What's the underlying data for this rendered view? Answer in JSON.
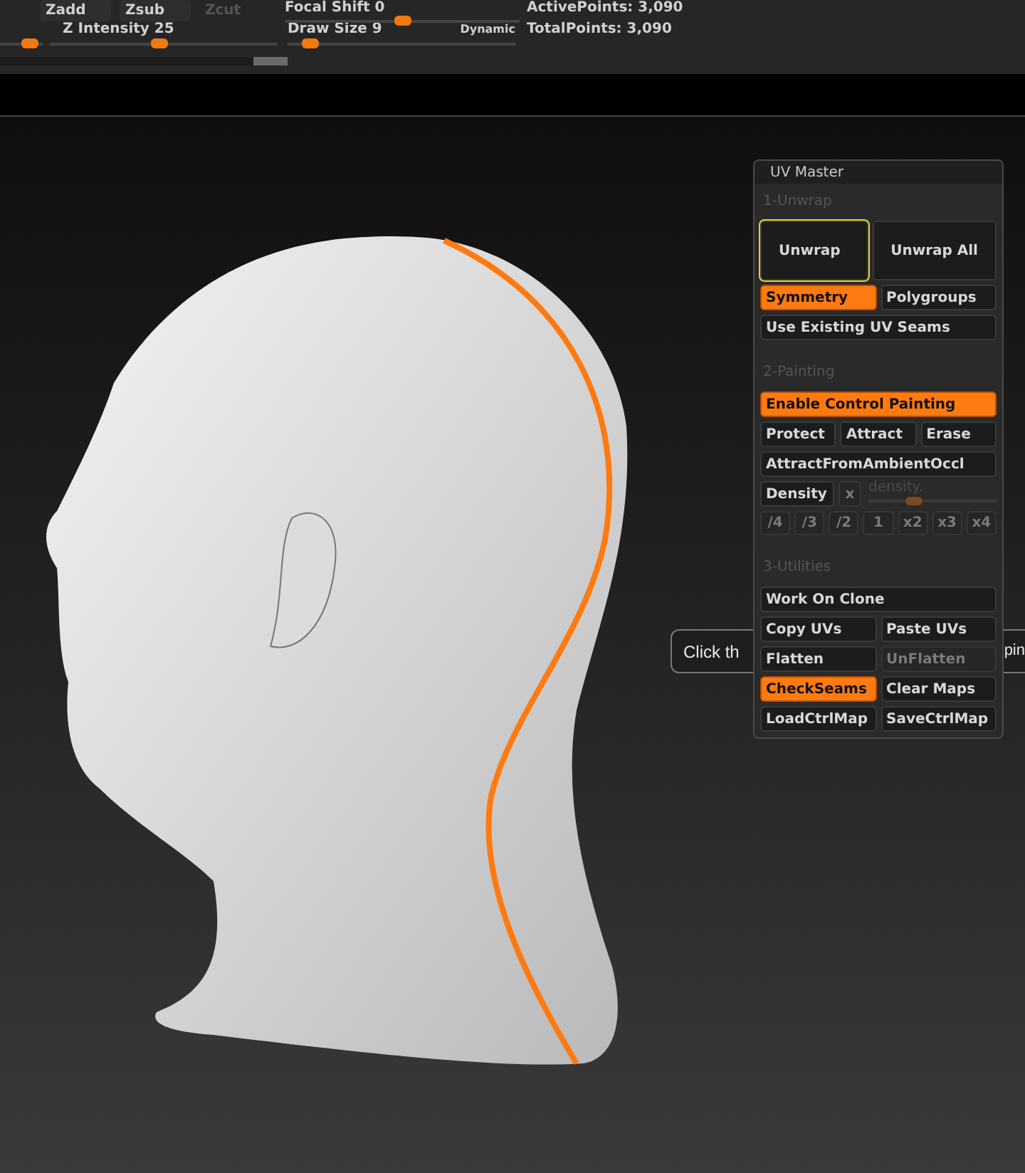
{
  "top_bar": {
    "brush_buttons": [
      {
        "label": "Zadd",
        "disabled": false
      },
      {
        "label": "Zsub",
        "disabled": false
      },
      {
        "label": "Zcut",
        "disabled": true
      }
    ],
    "left_slider": {
      "level": 0.7
    },
    "focal_shift": {
      "label": "Focal Shift 0",
      "level": 0.5
    },
    "active_points": "ActivePoints: 3,090",
    "z_intensity": {
      "label": "Z Intensity 25",
      "level": 0.48
    },
    "draw_size": {
      "label": "Draw Size 9",
      "level": 0.1
    },
    "dynamic": "Dynamic",
    "total_points": "TotalPoints: 3,090"
  },
  "tooltip": {
    "texts": [
      "Click th",
      "pin"
    ]
  },
  "uv_master": {
    "title": "UV Master",
    "sections": [
      {
        "heading": "1-Unwrap",
        "rows": [
          {
            "kind": "large",
            "buttons": [
              {
                "label": "Unwrap",
                "on": false,
                "disabled": false,
                "highlighted": true
              },
              {
                "label": "Unwrap All",
                "on": false,
                "disabled": false,
                "highlighted": false
              }
            ]
          },
          {
            "kind": "normal",
            "buttons": [
              {
                "label": "Symmetry",
                "on": true,
                "disabled": false,
                "highlighted": false
              },
              {
                "label": "Polygroups",
                "on": false,
                "disabled": false,
                "highlighted": false
              }
            ]
          },
          {
            "kind": "normal",
            "buttons": [
              {
                "label": "Use Existing UV Seams",
                "on": false,
                "disabled": false,
                "highlighted": false
              }
            ]
          }
        ]
      },
      {
        "heading": "2-Painting",
        "rows": [
          {
            "kind": "normal",
            "buttons": [
              {
                "label": "Enable Control Painting",
                "on": true,
                "disabled": false,
                "highlighted": false
              }
            ]
          },
          {
            "kind": "normal",
            "buttons": [
              {
                "label": "Protect",
                "on": false,
                "disabled": false,
                "highlighted": false
              },
              {
                "label": "Attract",
                "on": false,
                "disabled": false,
                "highlighted": false
              },
              {
                "label": "Erase",
                "on": false,
                "disabled": false,
                "highlighted": false
              }
            ]
          },
          {
            "kind": "normal",
            "buttons": [
              {
                "label": "AttractFromAmbientOccl",
                "on": false,
                "disabled": false,
                "highlighted": false
              }
            ]
          },
          {
            "kind": "density",
            "buttons": [
              {
                "label": "Density",
                "on": false,
                "disabled": false,
                "highlighted": false
              },
              {
                "label": "x",
                "on": false,
                "disabled": true,
                "highlighted": false
              }
            ],
            "slider": {
              "label": "density.",
              "level": 0.35,
              "disabled": true
            }
          },
          {
            "kind": "small",
            "buttons": [
              {
                "label": "/4",
                "on": false,
                "disabled": true,
                "highlighted": false
              },
              {
                "label": "/3",
                "on": false,
                "disabled": true,
                "highlighted": false
              },
              {
                "label": "/2",
                "on": false,
                "disabled": true,
                "highlighted": false
              },
              {
                "label": "1",
                "on": false,
                "disabled": true,
                "highlighted": false
              },
              {
                "label": "x2",
                "on": false,
                "disabled": true,
                "highlighted": false
              },
              {
                "label": "x3",
                "on": false,
                "disabled": true,
                "highlighted": false
              },
              {
                "label": "x4",
                "on": false,
                "disabled": true,
                "highlighted": false
              }
            ]
          }
        ]
      },
      {
        "heading": "3-Utilities",
        "rows": [
          {
            "kind": "normal",
            "buttons": [
              {
                "label": "Work On Clone",
                "on": false,
                "disabled": false,
                "highlighted": false
              }
            ]
          },
          {
            "kind": "normal",
            "buttons": [
              {
                "label": "Copy UVs",
                "on": false,
                "disabled": false,
                "highlighted": false
              },
              {
                "label": "Paste UVs",
                "on": false,
                "disabled": false,
                "highlighted": false
              }
            ]
          },
          {
            "kind": "normal",
            "buttons": [
              {
                "label": "Flatten",
                "on": false,
                "disabled": false,
                "highlighted": false
              },
              {
                "label": "UnFlatten",
                "on": false,
                "disabled": true,
                "highlighted": false
              }
            ]
          },
          {
            "kind": "normal",
            "buttons": [
              {
                "label": "CheckSeams",
                "on": true,
                "disabled": false,
                "highlighted": false
              },
              {
                "label": "Clear Maps",
                "on": false,
                "disabled": false,
                "highlighted": false
              }
            ]
          },
          {
            "kind": "normal",
            "buttons": [
              {
                "label": "LoadCtrlMap",
                "on": false,
                "disabled": false,
                "highlighted": false
              },
              {
                "label": "SaveCtrlMap",
                "on": false,
                "disabled": false,
                "highlighted": false
              }
            ]
          }
        ]
      }
    ]
  }
}
